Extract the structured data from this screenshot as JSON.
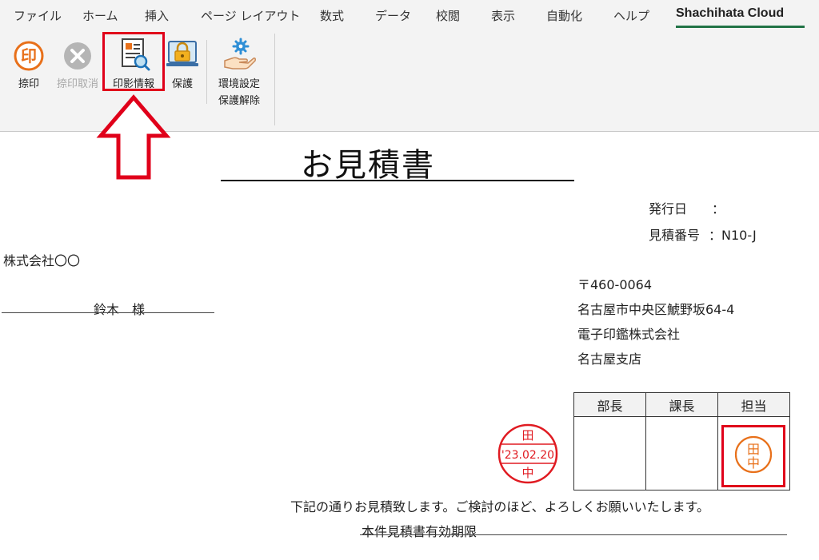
{
  "menu": {
    "tabs": [
      "ファイル",
      "ホーム",
      "挿入",
      "ページ レイアウト",
      "数式",
      "データ",
      "校閲",
      "表示",
      "自動化",
      "ヘルプ",
      "Shachihata Cloud"
    ],
    "active_tab": "Shachihata Cloud"
  },
  "ribbon": {
    "stamp_label": "捺印",
    "stamp_icon_char": "印",
    "cancel_label": "捺印取消",
    "info_label": "印影情報",
    "protect_label": "保護",
    "settings_label_line1": "環境設定",
    "settings_label_line2": "保護解除"
  },
  "document": {
    "title": "お見積書",
    "issue_date_label": "発行日",
    "issue_date_sep": "：",
    "quote_no_label": "見積番号",
    "quote_no_value": "：N10-J",
    "client_company": "株式会社〇〇",
    "client_person": "鈴木　様",
    "postal": "〒460-0064",
    "address": "名古屋市中央区鯱野坂64-4",
    "company": "電子印鑑株式会社",
    "branch": "名古屋支店",
    "approval_headers": [
      "部長",
      "課長",
      "担当"
    ],
    "date_stamp": {
      "top": "田",
      "date": "'23.02.20",
      "bottom": "中"
    },
    "personal_stamp": {
      "line1": "田",
      "line2": "中"
    },
    "message": "下記の通りお見積致します。ご検討のほど、よろしくお願いいたします。",
    "validity_label": "本件見積書有効期限"
  },
  "colors": {
    "excel_green": "#217346",
    "highlight_red": "#e0001a",
    "stamp_red": "#e01b22",
    "stamp_orange": "#e8701a"
  }
}
